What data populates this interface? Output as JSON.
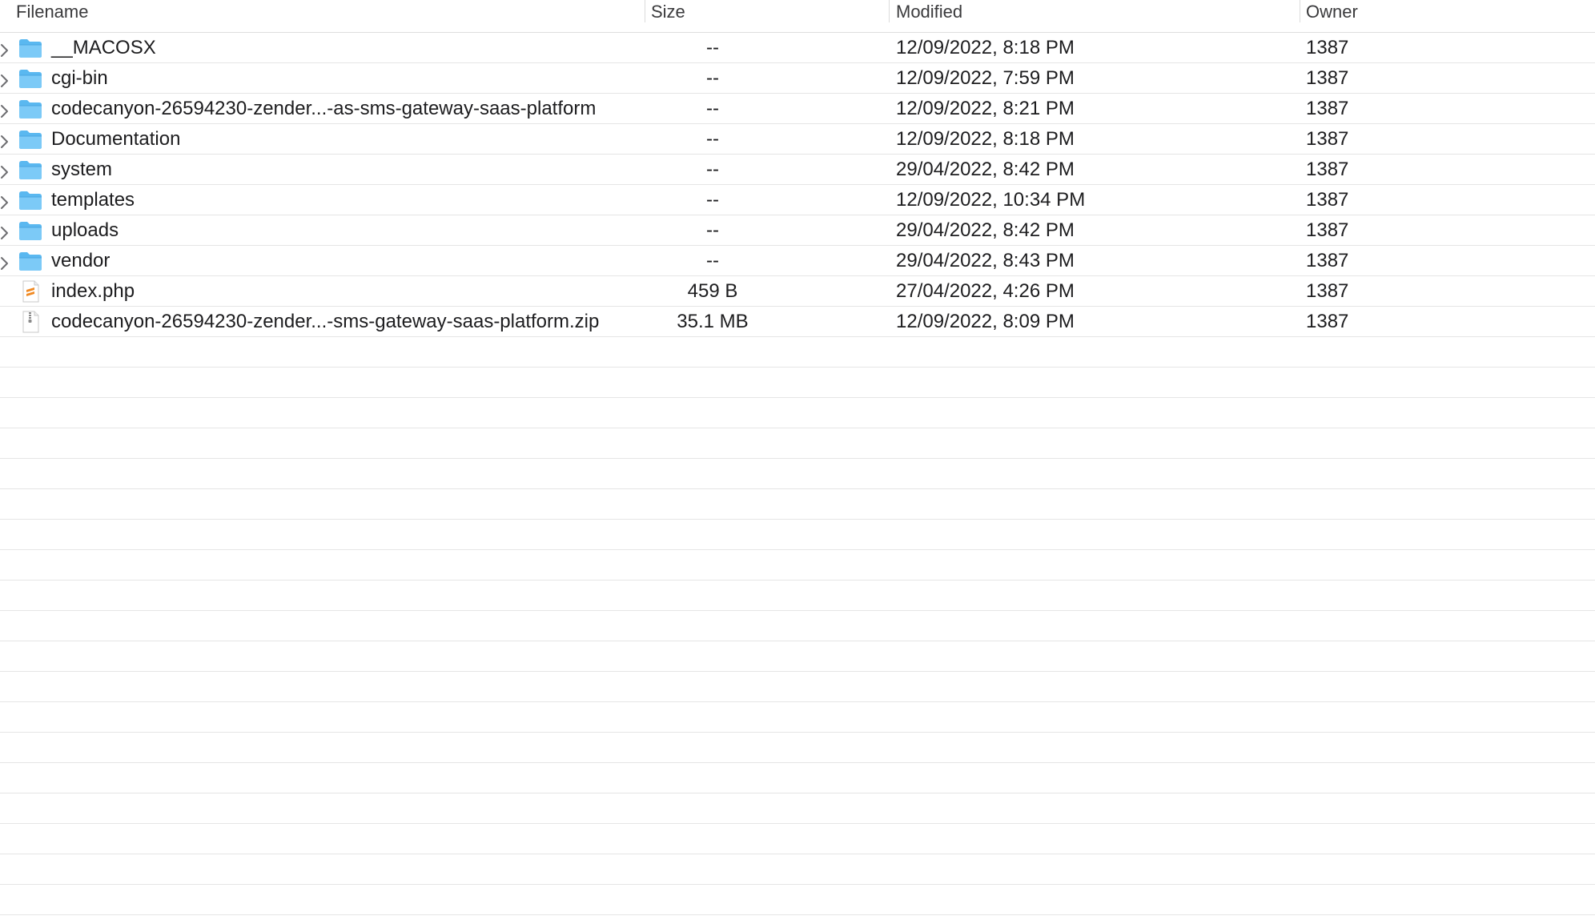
{
  "columns": {
    "filename": "Filename",
    "size": "Size",
    "modified": "Modified",
    "owner": "Owner"
  },
  "files": [
    {
      "name": "__MACOSX",
      "size": "--",
      "modified": "12/09/2022, 8:18 PM",
      "owner": "1387",
      "type": "folder"
    },
    {
      "name": "cgi-bin",
      "size": "--",
      "modified": "12/09/2022, 7:59 PM",
      "owner": "1387",
      "type": "folder"
    },
    {
      "name": "codecanyon-26594230-zender...-as-sms-gateway-saas-platform",
      "size": "--",
      "modified": "12/09/2022, 8:21 PM",
      "owner": "1387",
      "type": "folder"
    },
    {
      "name": "Documentation",
      "size": "--",
      "modified": "12/09/2022, 8:18 PM",
      "owner": "1387",
      "type": "folder"
    },
    {
      "name": "system",
      "size": "--",
      "modified": "29/04/2022, 8:42 PM",
      "owner": "1387",
      "type": "folder"
    },
    {
      "name": "templates",
      "size": "--",
      "modified": "12/09/2022, 10:34 PM",
      "owner": "1387",
      "type": "folder"
    },
    {
      "name": "uploads",
      "size": "--",
      "modified": "29/04/2022, 8:42 PM",
      "owner": "1387",
      "type": "folder"
    },
    {
      "name": "vendor",
      "size": "--",
      "modified": "29/04/2022, 8:43 PM",
      "owner": "1387",
      "type": "folder"
    },
    {
      "name": "index.php",
      "size": "459 B",
      "modified": "27/04/2022, 4:26 PM",
      "owner": "1387",
      "type": "php"
    },
    {
      "name": "codecanyon-26594230-zender...-sms-gateway-saas-platform.zip",
      "size": "35.1 MB",
      "modified": "12/09/2022, 8:09 PM",
      "owner": "1387",
      "type": "zip"
    }
  ],
  "icons": {
    "folder": "folder-icon",
    "php": "php-file-icon",
    "zip": "zip-file-icon",
    "disclosure": "chevron-right-icon"
  },
  "colors": {
    "folder": "#5ab8f0",
    "php_accent": "#f08a24",
    "row_border": "#e5e5e5"
  }
}
